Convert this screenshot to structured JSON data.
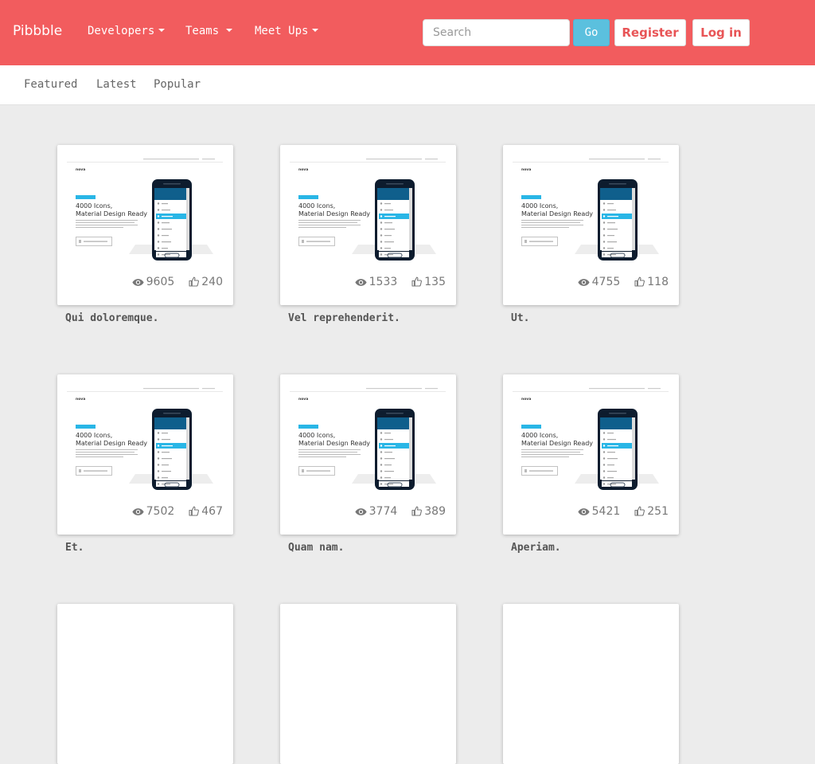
{
  "header": {
    "brand": "Pibbble",
    "nav": [
      {
        "label": "Developers"
      },
      {
        "label": "Teams"
      },
      {
        "label": "Meet Ups"
      }
    ],
    "search_placeholder": "Search",
    "go_label": "Go",
    "register_label": "Register",
    "login_label": "Log in",
    "accent_color": "#f25c5e"
  },
  "subnav": {
    "tabs": [
      {
        "label": "Featured"
      },
      {
        "label": "Latest"
      },
      {
        "label": "Popular"
      }
    ]
  },
  "shots": [
    {
      "title": "Qui doloremque.",
      "views": "9605",
      "likes": "240"
    },
    {
      "title": "Vel reprehenderit.",
      "views": "1533",
      "likes": "135"
    },
    {
      "title": "Ut.",
      "views": "4755",
      "likes": "118"
    },
    {
      "title": "Et.",
      "views": "7502",
      "likes": "467"
    },
    {
      "title": "Quam nam.",
      "views": "3774",
      "likes": "389"
    },
    {
      "title": "Aperiam.",
      "views": "5421",
      "likes": "251"
    }
  ],
  "thumbnail": {
    "brand": "nova",
    "headline_1": "4000 Icons,",
    "headline_2": "Material Design Ready"
  }
}
